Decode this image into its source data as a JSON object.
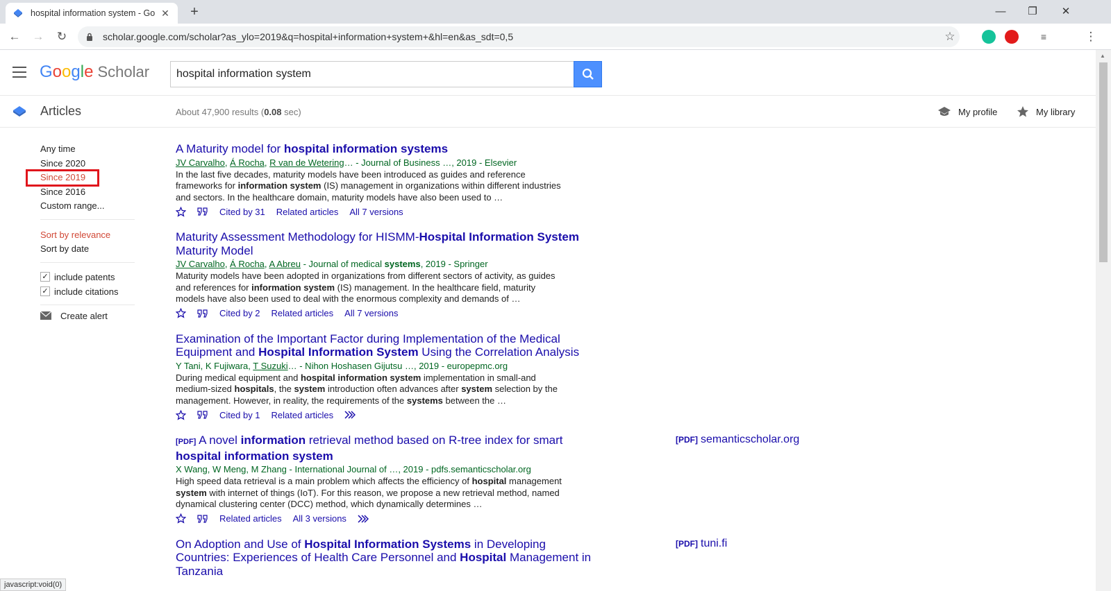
{
  "browser": {
    "tab_title": "hospital information system - Go",
    "url": "scholar.google.com/scholar?as_ylo=2019&q=hospital+information+system+&hl=en&as_sdt=0,5",
    "status": "javascript:void(0)"
  },
  "header": {
    "logo_letters": [
      "G",
      "o",
      "o",
      "g",
      "l",
      "e"
    ],
    "logo_colors": [
      "#4285f4",
      "#ea4335",
      "#fbbc05",
      "#4285f4",
      "#34a853",
      "#ea4335"
    ],
    "logo_suffix": "Scholar",
    "search_value": "hospital information system"
  },
  "subheader": {
    "section": "Articles",
    "results_prefix": "About 47,900 results (",
    "results_time": "0.08",
    "results_suffix": " sec)",
    "my_profile": "My profile",
    "my_library": "My library"
  },
  "sidebar": {
    "time_filters": [
      "Any time",
      "Since 2020",
      "Since 2019",
      "Since 2016",
      "Custom range..."
    ],
    "selected_time_filter": "Since 2019",
    "sort_relevance": "Sort by relevance",
    "sort_date": "Sort by date",
    "include_patents": "include patents",
    "include_citations": "include citations",
    "create_alert": "Create alert"
  },
  "results": [
    {
      "title_parts": [
        [
          "A Maturity model for ",
          false
        ],
        [
          "hospital information systems",
          true
        ]
      ],
      "meta": [
        [
          "JV Carvalho",
          true
        ],
        [
          ", ",
          false
        ],
        [
          "Á Rocha",
          true
        ],
        [
          ", ",
          false
        ],
        [
          "R van de Wetering",
          true
        ],
        [
          "… - Journal of Business …, 2019 - Elsevier",
          false
        ]
      ],
      "snippet": "In the last five decades, maturity models have been introduced as guides and reference frameworks for <b>information system</b> (IS) management in organizations within different industries and sectors. In the healthcare domain, maturity models have also been used to …",
      "links": [
        "Cited by 31",
        "Related articles",
        "All 7 versions"
      ],
      "side": null
    },
    {
      "title_parts": [
        [
          "Maturity Assessment Methodology for HISMM-",
          false
        ],
        [
          "Hospital Information System",
          true
        ],
        [
          " Maturity Model",
          false
        ]
      ],
      "meta": [
        [
          "JV Carvalho",
          true
        ],
        [
          ", ",
          false
        ],
        [
          "Á Rocha",
          true
        ],
        [
          ", ",
          false
        ],
        [
          "A Abreu",
          true
        ],
        [
          " - Journal of medical ",
          false
        ],
        [
          "systems",
          "bold"
        ],
        [
          ", 2019 - Springer",
          false
        ]
      ],
      "snippet": "Maturity models have been adopted in organizations from different sectors of activity, as guides and references for <b>information system</b> (IS) management. In the healthcare field, maturity models have also been used to deal with the enormous complexity and demands of …",
      "links": [
        "Cited by 2",
        "Related articles",
        "All 7 versions"
      ],
      "side": null
    },
    {
      "title_parts": [
        [
          "Examination of the Important Factor during Implementation of the Medical Equipment and ",
          false
        ],
        [
          "Hospital Information System",
          true
        ],
        [
          " Using the Correlation Analysis",
          false
        ]
      ],
      "meta": [
        [
          "Y Tani, K Fujiwara, ",
          false
        ],
        [
          "T Suzuki",
          true
        ],
        [
          "… - Nihon Hoshasen Gijutsu …, 2019 - europepmc.org",
          false
        ]
      ],
      "snippet": "During medical equipment and <b>hospital information system</b> implementation in small-and medium-sized <b>hospitals</b>, the <b>system</b> introduction often advances after <b>system</b> selection by the management. However, in reality, the requirements of the <b>systems</b> between the …",
      "links": [
        "Cited by 1",
        "Related articles"
      ],
      "more": true,
      "side": null
    },
    {
      "pdf_tag": "[PDF]",
      "title_parts": [
        [
          " A novel ",
          false
        ],
        [
          "information",
          true
        ],
        [
          " retrieval method based on R-tree index for smart ",
          false
        ],
        [
          "hospital information system",
          true
        ]
      ],
      "meta": [
        [
          "X Wang, W Meng, M Zhang - International Journal of …, 2019 - pdfs.semanticscholar.org",
          false
        ]
      ],
      "snippet": "High speed data retrieval is a main problem which affects the efficiency of <b>hospital</b> management <b>system</b> with internet of things (IoT). For this reason, we propose a new retrieval method, named dynamical clustering center (DCC) method, which dynamically determines …",
      "links": [
        "Related articles",
        "All 3 versions"
      ],
      "no_cite": true,
      "more": true,
      "side": {
        "tag": "[PDF]",
        "domain": "semanticscholar.org"
      }
    },
    {
      "title_parts": [
        [
          "On Adoption and Use of ",
          false
        ],
        [
          "Hospital Information Systems",
          true
        ],
        [
          " in Developing Countries: Experiences of Health Care Personnel and ",
          false
        ],
        [
          "Hospital",
          true
        ],
        [
          " Management in Tanzania",
          false
        ]
      ],
      "meta": [],
      "snippet": "",
      "links": [],
      "side": {
        "tag": "[PDF]",
        "domain": "tuni.fi"
      }
    }
  ]
}
